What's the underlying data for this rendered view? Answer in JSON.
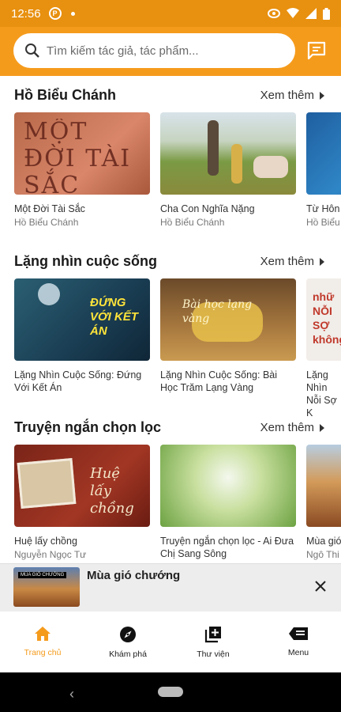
{
  "status": {
    "time": "12:56",
    "app_badge": "P"
  },
  "search": {
    "placeholder": "Tìm kiếm tác giả, tác phẩm..."
  },
  "sections": [
    {
      "title": "Hồ Biểu Chánh",
      "more": "Xem thêm",
      "cards": [
        {
          "title": "Một Đời Tài Sắc",
          "author": "Hồ Biểu Chánh",
          "art_text": "MỘT ĐỜI TÀI SẮC"
        },
        {
          "title": "Cha Con Nghĩa Nặng",
          "author": "Hồ Biểu Chánh"
        },
        {
          "title": "Từ Hôn",
          "author": "Hồ Biểu"
        }
      ]
    },
    {
      "title": "Lặng nhìn cuộc sống",
      "more": "Xem thêm",
      "cards": [
        {
          "title": "Lặng Nhìn Cuộc Sống: Đứng Với Kết Án",
          "author": "",
          "art_text": "ĐỨNG VỚI KẾT ÁN"
        },
        {
          "title": "Lặng Nhìn Cuộc Sống: Bài Học Trăm Lạng Vàng",
          "author": "",
          "art_text": "Bài học lạng vàng"
        },
        {
          "title": "Lặng Nhìn Nỗi Sợ K",
          "author": "",
          "art_text": "nhữ NỖI SỢ không"
        }
      ]
    },
    {
      "title": "Truyện ngắn chọn lọc",
      "more": "Xem thêm",
      "cards": [
        {
          "title": "Huệ lấy chồng",
          "author": "Nguyễn Ngọc Tư",
          "art_text": "Huệ lấy chồng"
        },
        {
          "title": "Truyện ngắn chọn lọc - Ai Đưa Chị Sang Sông",
          "author": ""
        },
        {
          "title": "Mùa gió",
          "author": "Ngô Thi"
        }
      ]
    }
  ],
  "mini_player": {
    "title": "Mùa gió chướng",
    "thumb_text": "MÙA GIÓ CHƯỚNG"
  },
  "nav": [
    {
      "label": "Trang chủ",
      "icon": "home-icon",
      "active": true
    },
    {
      "label": "Khám phá",
      "icon": "compass-icon",
      "active": false
    },
    {
      "label": "Thư viện",
      "icon": "library-icon",
      "active": false
    },
    {
      "label": "Menu",
      "icon": "menu-icon",
      "active": false
    }
  ],
  "colors": {
    "accent": "#f59b1c",
    "statusbar": "#e8900f"
  }
}
